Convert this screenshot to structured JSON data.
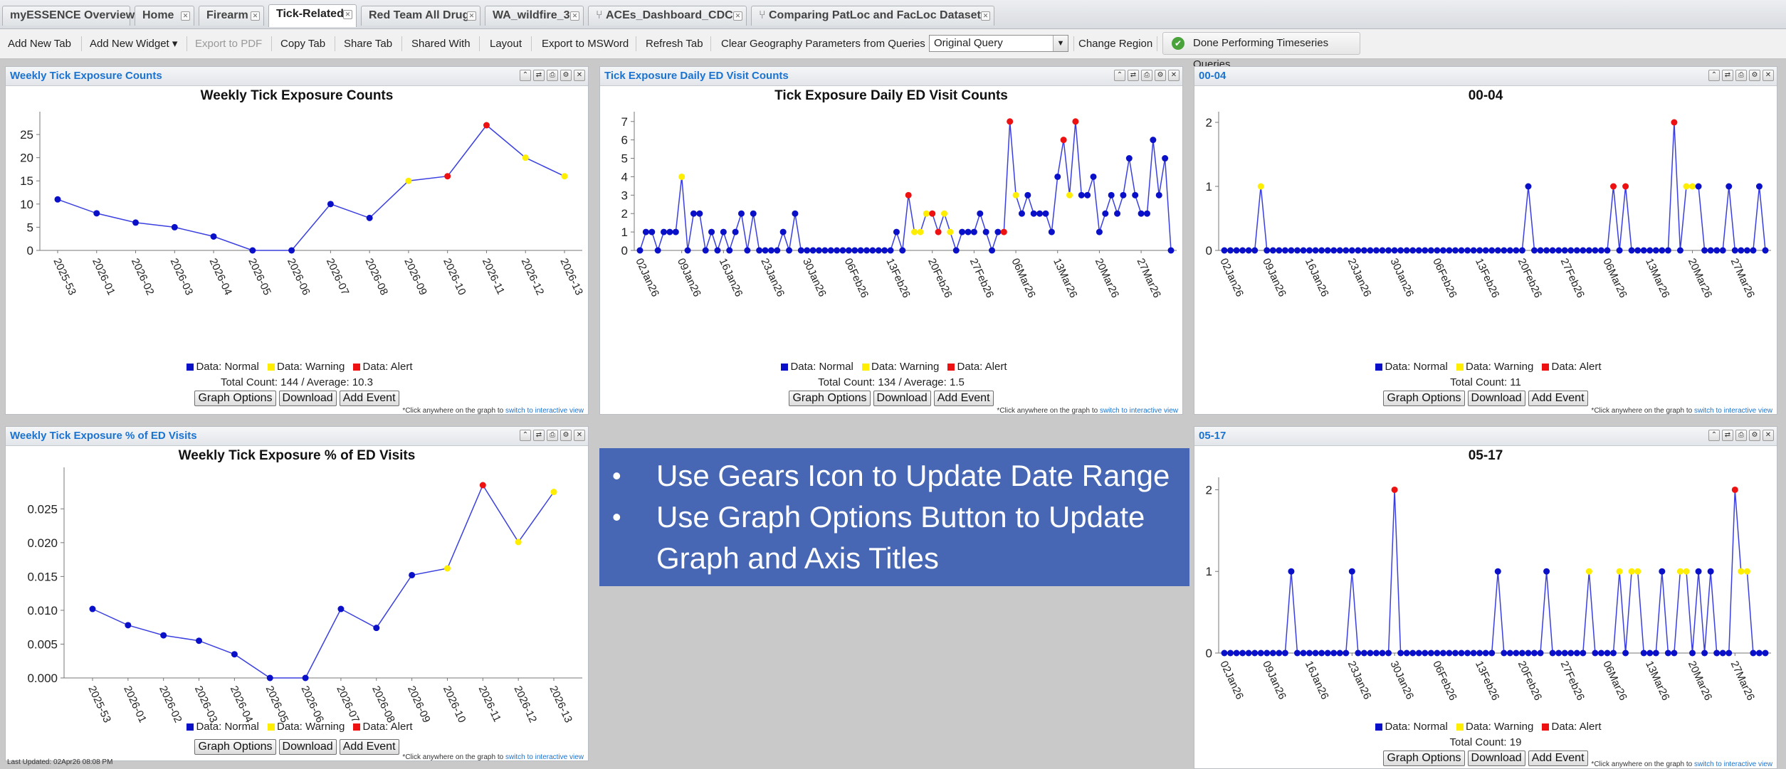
{
  "tabs": [
    {
      "label": "myESSENCE Overview",
      "closable": false
    },
    {
      "label": "Home",
      "closable": true
    },
    {
      "label": "Firearm",
      "closable": true
    },
    {
      "label": "Tick-Related",
      "closable": true,
      "active": true
    },
    {
      "label": "Red Team All Drug",
      "closable": true
    },
    {
      "label": "WA_wildfire_3",
      "closable": true
    },
    {
      "label": "ACEs_Dashboard_CDC",
      "closable": true,
      "icon": "network-icon"
    },
    {
      "label": "Comparing PatLoc and FacLoc Datasets",
      "closable": true,
      "icon": "network-icon"
    }
  ],
  "toolbar": {
    "add_tab": "Add New Tab",
    "add_widget": "Add New Widget ▾",
    "export_pdf": "Export to PDF",
    "copy_tab": "Copy Tab",
    "share_tab": "Share Tab",
    "shared_with": "Shared With",
    "layout": "Layout",
    "export_msword": "Export to MSWord",
    "refresh_tab": "Refresh Tab",
    "clear_geo": "Clear Geography Parameters from Queries",
    "query_select": "Original Query",
    "change_region": "Change Region",
    "done_timeseries": "Done Performing Timeseries Queries"
  },
  "common": {
    "legend_normal": "Data: Normal",
    "legend_warning": "Data: Warning",
    "legend_alert": "Data: Alert",
    "btn_graph_options": "Graph Options",
    "btn_download": "Download",
    "btn_add_event": "Add Event",
    "note_prefix": "*Click anywhere on the graph to",
    "note_link": "switch to interactive view",
    "colors": {
      "normal": "#0a10c8",
      "warning": "#ffee00",
      "alert": "#ee1111",
      "line": "#3b3fe0",
      "link": "#1a73d1"
    }
  },
  "panels": {
    "p1": {
      "header": "Weekly Tick Exposure Counts",
      "total": "Total Count: 144 / Average: 10.3"
    },
    "p2": {
      "header": "Tick Exposure Daily ED Visit Counts",
      "total": "Total Count: 134 / Average: 1.5"
    },
    "p3": {
      "header": "00-04",
      "total": "Total Count: 11"
    },
    "p4": {
      "header": "Weekly Tick Exposure % of ED Visits"
    },
    "p5": {
      "header": "05-17",
      "total": "Total Count: 19"
    }
  },
  "last_updated": "Last Updated: 02Apr26 08:08 PM",
  "bullets": [
    "Use Gears Icon to Update Date Range",
    "Use Graph Options Button to Update Graph and Axis Titles"
  ],
  "chart_data": [
    {
      "id": "weekly_counts",
      "type": "line",
      "title": "Weekly Tick Exposure Counts",
      "categories": [
        "2025-53",
        "2026-01",
        "2026-02",
        "2026-03",
        "2026-04",
        "2026-05",
        "2026-06",
        "2026-07",
        "2026-08",
        "2026-09",
        "2026-10",
        "2026-11",
        "2026-12",
        "2026-13"
      ],
      "values": [
        11,
        8,
        6,
        5,
        3,
        0,
        0,
        10,
        7,
        15,
        16,
        27,
        20,
        16
      ],
      "status": [
        "n",
        "n",
        "n",
        "n",
        "n",
        "n",
        "n",
        "n",
        "n",
        "w",
        "a",
        "a",
        "w",
        "w"
      ],
      "ylim": [
        0,
        29
      ],
      "yticks": [
        0,
        5,
        10,
        15,
        20,
        25
      ],
      "ytick_labels": [
        "0",
        "5",
        "10",
        "15",
        "20",
        "25"
      ]
    },
    {
      "id": "daily_counts",
      "type": "line",
      "title": "Tick Exposure Daily ED Visit Counts",
      "tick_labels": [
        "02Jan26",
        "09Jan26",
        "16Jan26",
        "23Jan26",
        "30Jan26",
        "06Feb26",
        "13Feb26",
        "20Feb26",
        "27Feb26",
        "06Mar26",
        "13Mar26",
        "20Mar26",
        "27Mar26"
      ],
      "values": [
        0,
        1,
        1,
        0,
        1,
        1,
        1,
        4,
        0,
        2,
        2,
        0,
        1,
        0,
        1,
        0,
        1,
        2,
        0,
        2,
        0,
        0,
        0,
        0,
        1,
        0,
        2,
        0,
        0,
        0,
        0,
        0,
        0,
        0,
        0,
        0,
        0,
        0,
        0,
        0,
        0,
        0,
        0,
        1,
        0,
        3,
        1,
        1,
        2,
        2,
        1,
        2,
        1,
        0,
        1,
        1,
        1,
        2,
        1,
        0,
        1,
        1,
        7,
        3,
        2,
        3,
        2,
        2,
        2,
        1,
        4,
        6,
        3,
        7,
        3,
        3,
        4,
        1,
        2,
        3,
        2,
        3,
        5,
        3,
        2,
        2,
        6,
        3,
        5,
        0
      ],
      "status": "nnnnnnnwnnnnnnnnnnnnnnnnnnnnnnnnnnnnnnnnnnnnnawwwaawwnnnnnnnnaawnnnnnnnawannnnnnnnnnnnnnnnnn",
      "ylim": [
        0,
        7.3
      ],
      "yticks": [
        0,
        1,
        2,
        3,
        4,
        5,
        6,
        7
      ],
      "ytick_labels": [
        "0",
        "1",
        "2",
        "3",
        "4",
        "5",
        "6",
        "7"
      ]
    },
    {
      "id": "age_00_04",
      "type": "line",
      "title": "00-04",
      "tick_labels": [
        "02Jan26",
        "09Jan26",
        "16Jan26",
        "23Jan26",
        "30Jan26",
        "06Feb26",
        "13Feb26",
        "20Feb26",
        "27Feb26",
        "06Mar26",
        "13Mar26",
        "20Mar26",
        "27Mar26"
      ],
      "nonzero": {
        "6": 1,
        "50": 1,
        "64": 1,
        "66": 1,
        "74": 2,
        "76": 1,
        "77": 1,
        "78": 1,
        "83": 1,
        "88": 1
      },
      "status_override": {
        "6": "w",
        "64": "a",
        "66": "a",
        "74": "a",
        "76": "w",
        "77": "w"
      },
      "n_points": 90,
      "ylim": [
        0,
        2.1
      ],
      "yticks": [
        0,
        1,
        2
      ],
      "ytick_labels": [
        "0",
        "1",
        "2"
      ]
    },
    {
      "id": "weekly_pct",
      "type": "line",
      "title": "Weekly Tick Exposure % of ED Visits",
      "categories": [
        "2025-53",
        "2026-01",
        "2026-02",
        "2026-03",
        "2026-04",
        "2026-05",
        "2026-06",
        "2026-07",
        "2026-08",
        "2026-09",
        "2026-10",
        "2026-11",
        "2026-12",
        "2026-13"
      ],
      "values": [
        0.0102,
        0.0078,
        0.0063,
        0.0055,
        0.0035,
        0.0,
        0.0,
        0.0102,
        0.0074,
        0.0152,
        0.0162,
        0.0285,
        0.0201,
        0.0275
      ],
      "status": [
        "n",
        "n",
        "n",
        "n",
        "n",
        "n",
        "n",
        "n",
        "n",
        "n",
        "w",
        "a",
        "w",
        "w"
      ],
      "ylim": [
        0,
        0.0305
      ],
      "yticks": [
        0,
        0.005,
        0.01,
        0.015,
        0.02,
        0.025
      ],
      "ytick_labels": [
        "0.000",
        "0.005",
        "0.010",
        "0.015",
        "0.020",
        "0.025"
      ]
    },
    {
      "id": "age_05_17",
      "type": "line",
      "title": "05-17",
      "tick_labels": [
        "02Jan26",
        "09Jan26",
        "16Jan26",
        "23Jan26",
        "30Jan26",
        "06Feb26",
        "13Feb26",
        "20Feb26",
        "27Feb26",
        "06Mar26",
        "13Mar26",
        "20Mar26",
        "27Mar26"
      ],
      "nonzero": {
        "11": 1,
        "21": 1,
        "28": 2,
        "45": 1,
        "53": 1,
        "60": 1,
        "65": 1,
        "67": 1,
        "68": 1,
        "72": 1,
        "75": 1,
        "76": 1,
        "78": 1,
        "80": 1,
        "84": 2,
        "85": 1,
        "86": 1
      },
      "status_override": {
        "28": "a",
        "60": "w",
        "65": "w",
        "67": "w",
        "68": "w",
        "75": "w",
        "76": "w",
        "84": "a",
        "85": "w",
        "86": "w"
      },
      "n_points": 90,
      "ylim": [
        0,
        2.1
      ],
      "yticks": [
        0,
        1,
        2
      ],
      "ytick_labels": [
        "0",
        "1",
        "2"
      ]
    }
  ]
}
